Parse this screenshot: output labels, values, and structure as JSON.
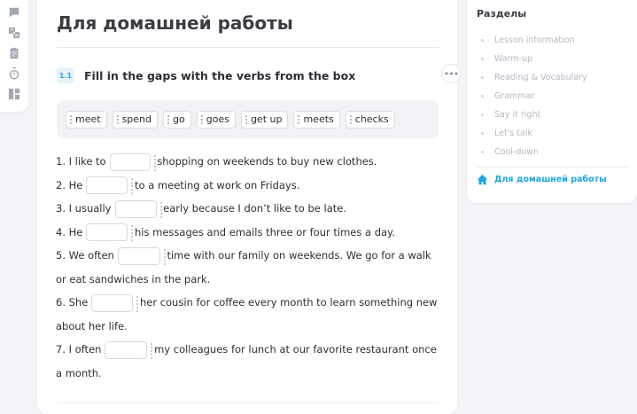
{
  "toolbar": {
    "items": [
      {
        "icon": "chat-icon"
      },
      {
        "icon": "translate-icon"
      },
      {
        "icon": "clipboard-icon"
      },
      {
        "icon": "timer-icon"
      },
      {
        "icon": "layout-icon"
      }
    ]
  },
  "main": {
    "title": "Для домашней работы",
    "exercise": {
      "number": "1.1",
      "title": "Fill in the gaps with the verbs from the box",
      "more_label": "•••",
      "words": [
        "meet",
        "spend",
        "go",
        "goes",
        "get up",
        "meets",
        "checks"
      ],
      "sentences": [
        {
          "before": "1. I like to",
          "after": "shopping on weekends to buy new clothes."
        },
        {
          "before": "2. He",
          "after": "to a meeting at work on Fridays."
        },
        {
          "before": "3. I usually",
          "after": "early because I don’t like to be late."
        },
        {
          "before": "4. He",
          "after": "his messages and emails three or four times a day."
        },
        {
          "before": "5. We often",
          "after": "time with our family on weekends. We go for a walk or eat sandwiches in the park."
        },
        {
          "before": "6. She",
          "after": "her cousin for coffee every month to learn something new about her life."
        },
        {
          "before": "7. I often",
          "after": "my colleagues for lunch at our favorite restaurant once a month."
        }
      ]
    }
  },
  "sidebar": {
    "title": "Разделы",
    "items": [
      {
        "label": "Lesson information"
      },
      {
        "label": "Warm-up"
      },
      {
        "label": "Reading & Vocabulary"
      },
      {
        "label": "Grammar"
      },
      {
        "label": "Say it right"
      },
      {
        "label": "Let's talk"
      },
      {
        "label": "Cool-down"
      }
    ],
    "active": {
      "label": "Для домашней работы",
      "icon": "home-icon"
    }
  },
  "colors": {
    "accent": "#1ea6e2",
    "background": "#f3f4f7"
  }
}
